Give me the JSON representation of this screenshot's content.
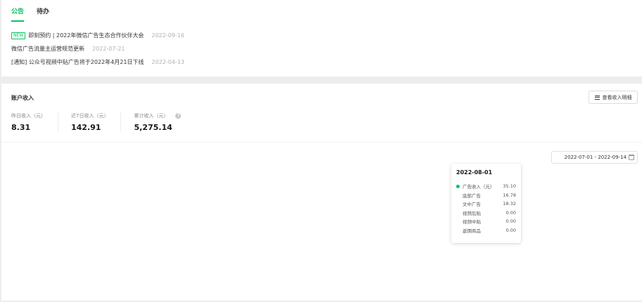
{
  "tabs": [
    {
      "label": "公告",
      "active": true
    },
    {
      "label": "待办",
      "active": false
    }
  ],
  "notices": [
    {
      "badge": "NEW",
      "title": "即刻预约 | 2022年微信广告生态合作伙伴大会",
      "date": "2022-09-16"
    },
    {
      "badge": "",
      "title": "微信广告流量主运营规范更新",
      "date": "2022-07-21"
    },
    {
      "badge": "",
      "title": "[通知] 公众号视频中贴广告将于2022年4月21日下线",
      "date": "2022-04-13"
    }
  ],
  "income": {
    "title": "账户收入",
    "detail_button": "查看收入明细",
    "stats": [
      {
        "label": "昨日收入（元）",
        "value": "8.31"
      },
      {
        "label": "近7日收入（元）",
        "value": "142.91"
      },
      {
        "label": "累计收入（元）",
        "value": "5,275.14"
      }
    ],
    "help_icon": "?",
    "date_range": "2022-07-01 - 2022-09-14"
  },
  "tooltip": {
    "date": "2022-08-01",
    "rows": [
      {
        "label": "广告收入（元）",
        "value": "35.10",
        "dot": true
      },
      {
        "label": "底部广告",
        "value": "16.78",
        "dot": false
      },
      {
        "label": "文中广告",
        "value": "18.32",
        "dot": false
      },
      {
        "label": "视频后贴",
        "value": "0.00",
        "dot": false
      },
      {
        "label": "视频中贴",
        "value": "0.00",
        "dot": false
      },
      {
        "label": "返佣商品",
        "value": "0.00",
        "dot": false
      }
    ]
  },
  "colors": {
    "accent": "#07c160",
    "background": "#ededed",
    "text": "#353535",
    "muted": "#b2b2b2"
  },
  "icons": {
    "list": "list-icon",
    "help": "help-icon",
    "calendar": "calendar-icon"
  }
}
